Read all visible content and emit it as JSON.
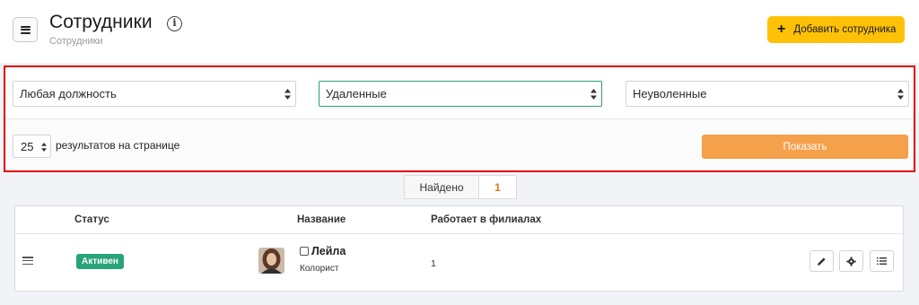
{
  "header": {
    "title": "Сотрудники",
    "breadcrumb": "Сотрудники",
    "add_button_label": "Добавить сотрудника",
    "info_icon": "info-icon",
    "menu_icon": "menu-icon"
  },
  "filters": {
    "position_select": "Любая должность",
    "deleted_select": "Удаленные",
    "dismissed_select": "Неуволенные",
    "per_page_value": "25",
    "per_page_label": "результатов на странице",
    "show_button_label": "Показать"
  },
  "found": {
    "label": "Найдено",
    "count": "1"
  },
  "table": {
    "columns": [
      "Статус",
      "Название",
      "Работает в филиалах"
    ],
    "rows": [
      {
        "status": "Активен",
        "name": "Лейла",
        "role": "Колорист",
        "branches": "1"
      }
    ]
  },
  "colors": {
    "accent_yellow": "#ffc107",
    "show_orange": "#f5a04b",
    "status_green": "#28a37a",
    "highlight_red": "#e00000",
    "active_select_border": "#2e9e7b",
    "found_count": "#e8741b"
  },
  "icons": {
    "row_actions": [
      "pencil-icon",
      "gear-icon",
      "list-icon"
    ],
    "drag_handle": "drag-handle-icon",
    "external_link": "external-link-icon"
  }
}
